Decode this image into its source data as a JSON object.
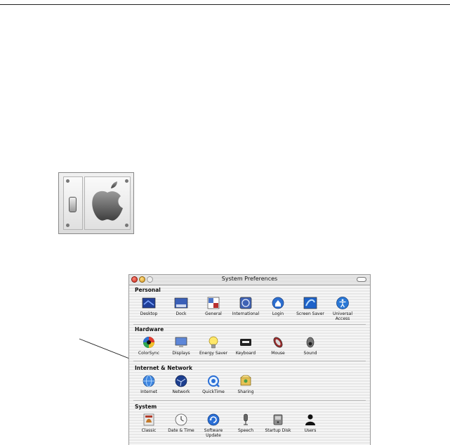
{
  "window": {
    "title": "System Preferences"
  },
  "sections": [
    {
      "title": "Personal",
      "items": [
        {
          "label": "Desktop",
          "icon": "desktop-icon"
        },
        {
          "label": "Dock",
          "icon": "dock-icon"
        },
        {
          "label": "General",
          "icon": "general-icon"
        },
        {
          "label": "International",
          "icon": "international-icon"
        },
        {
          "label": "Login",
          "icon": "login-icon"
        },
        {
          "label": "Screen Saver",
          "icon": "screen-saver-icon"
        },
        {
          "label": "Universal\nAccess",
          "icon": "universal-access-icon"
        }
      ]
    },
    {
      "title": "Hardware",
      "items": [
        {
          "label": "ColorSync",
          "icon": "colorsync-icon"
        },
        {
          "label": "Displays",
          "icon": "displays-icon"
        },
        {
          "label": "Energy Saver",
          "icon": "energy-saver-icon"
        },
        {
          "label": "Keyboard",
          "icon": "keyboard-icon"
        },
        {
          "label": "Mouse",
          "icon": "mouse-icon"
        },
        {
          "label": "Sound",
          "icon": "sound-icon"
        }
      ]
    },
    {
      "title": "Internet & Network",
      "items": [
        {
          "label": "Internet",
          "icon": "internet-icon"
        },
        {
          "label": "Network",
          "icon": "network-icon"
        },
        {
          "label": "QuickTime",
          "icon": "quicktime-icon"
        },
        {
          "label": "Sharing",
          "icon": "sharing-icon"
        }
      ]
    },
    {
      "title": "System",
      "items": [
        {
          "label": "Classic",
          "icon": "classic-icon"
        },
        {
          "label": "Date & Time",
          "icon": "date-time-icon"
        },
        {
          "label": "Software\nUpdate",
          "icon": "software-update-icon"
        },
        {
          "label": "Speech",
          "icon": "speech-icon"
        },
        {
          "label": "Startup Disk",
          "icon": "startup-disk-icon"
        },
        {
          "label": "Users",
          "icon": "users-icon"
        }
      ]
    }
  ],
  "colors": {
    "aqua_blue": "#2a6fd6",
    "close_red": "#d23a2c",
    "minimize_yellow": "#e0a82a"
  }
}
